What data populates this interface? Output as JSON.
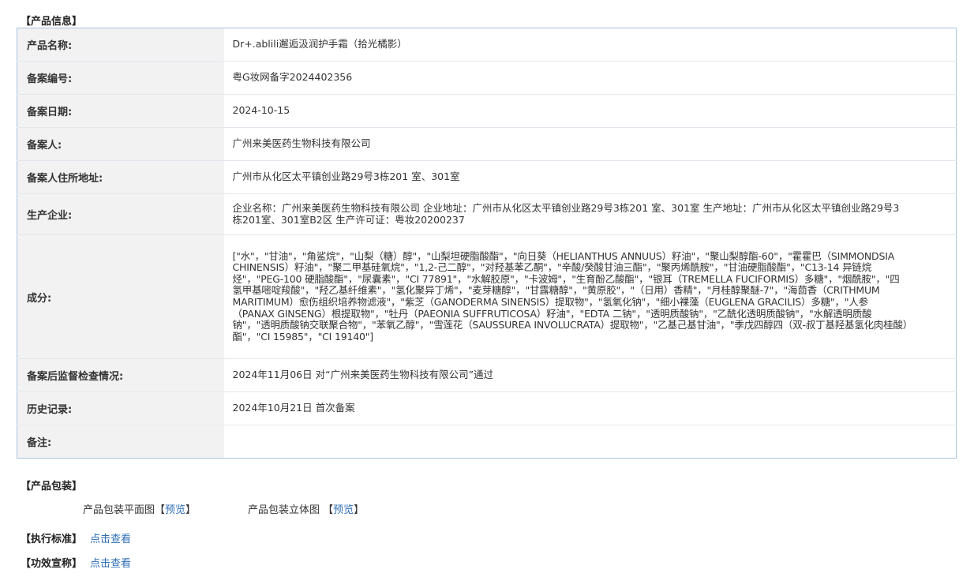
{
  "sections": {
    "info_title": "【产品信息】",
    "package_title": "【产品包装】",
    "standard_title": "【执行标准】",
    "efficacy_title": "【功效宣称】"
  },
  "info_rows": [
    {
      "label": "产品名称:",
      "value": "Dr+.ablili邂逅汲润护手霜（拾光橘影）"
    },
    {
      "label": "备案编号:",
      "value": "粤G妆网备字2024402356"
    },
    {
      "label": "备案日期:",
      "value": "2024-10-15"
    },
    {
      "label": "备案人:",
      "value": "广州来美医药生物科技有限公司"
    },
    {
      "label": "备案人住所地址:",
      "value": "广州市从化区太平镇创业路29号3栋201 室、301室"
    },
    {
      "label": "生产企业:",
      "value": "企业名称：广州来美医药生物科技有限公司 企业地址：广州市从化区太平镇创业路29号3栋201 室、301室 生产地址：广州市从化区太平镇创业路29号3栋201室、301室B2区 生产许可证：粤妆20200237"
    },
    {
      "label": "成分:",
      "value": "[\"水\"，\"甘油\"，\"角鲨烷\"，\"山梨（糖）醇\"，\"山梨坦硬脂酸酯\"，\"向日葵（HELIANTHUS ANNUUS）籽油\"，\"聚山梨醇酯-60\"，\"霍霍巴（SIMMONDSIA CHINENSIS）籽油\"，\"聚二甲基硅氧烷\"，\"1,2-己二醇\"，\"对羟基苯乙酮\"，\"辛酸/癸酸甘油三酯\"，\"聚丙烯酰胺\"，\"甘油硬脂酸酯\"，\"C13-14 异链烷烃\"，\"PEG-100 硬脂酸酯\"，\"尿囊素\"，\"CI 77891\"，\"水解胶原\"，\"卡波姆\"，\"生育酚乙酸酯\"，\"银耳（TREMELLA FUCIFORMIS）多糖\"，\"烟酰胺\"，\"四氢甲基嘧啶羧酸\"，\"羟乙基纤维素\"，\"氢化聚异丁烯\"，\"麦芽糖醇\"，\"甘露糖醇\"，\"黄原胶\"，\"（日用）香精\"，\"月桂醇聚醚-7\"，\"海茴香（CRITHMUM MARITIMUM）愈伤组织培养物滤液\"，\"紫芝（GANODERMA SINENSIS）提取物\"，\"氢氧化钠\"，\"细小裸藻（EUGLENA GRACILIS）多糖\"，\"人参（PANAX GINSENG）根提取物\"，\"牡丹（PAEONIA SUFFRUTICOSA）籽油\"，\"EDTA 二钠\"，\"透明质酸钠\"，\"乙酰化透明质酸钠\"，\"水解透明质酸钠\"，\"透明质酸钠交联聚合物\"，\"苯氧乙醇\"，\"雪莲花（SAUSSUREA INVOLUCRATA）提取物\"，\"乙基己基甘油\"，\"季戊四醇四（双-叔丁基羟基氢化肉桂酸）酯\"，\"CI 15985\"，\"CI 19140\"]"
    },
    {
      "label": "备案后监督检查情况:",
      "value": "2024年11月06日 对“广州来美医药生物科技有限公司”通过"
    },
    {
      "label": "历史记录:",
      "value": "2024年10月21日 首次备案"
    },
    {
      "label": "备注:",
      "value": ""
    }
  ],
  "package": {
    "flat_label": "产品包装平面图【",
    "flat_link": "预览",
    "flat_close": "】",
    "three_d_label": "产品包装立体图 【",
    "three_d_link": "预览",
    "three_d_close": "】"
  },
  "standard": {
    "link": "点击查看"
  },
  "efficacy": {
    "link": "点击查看"
  },
  "colors": {
    "link": "#2f6fb5",
    "table_border": "#a9c3e0",
    "label_bg": "#f2f2f2"
  }
}
